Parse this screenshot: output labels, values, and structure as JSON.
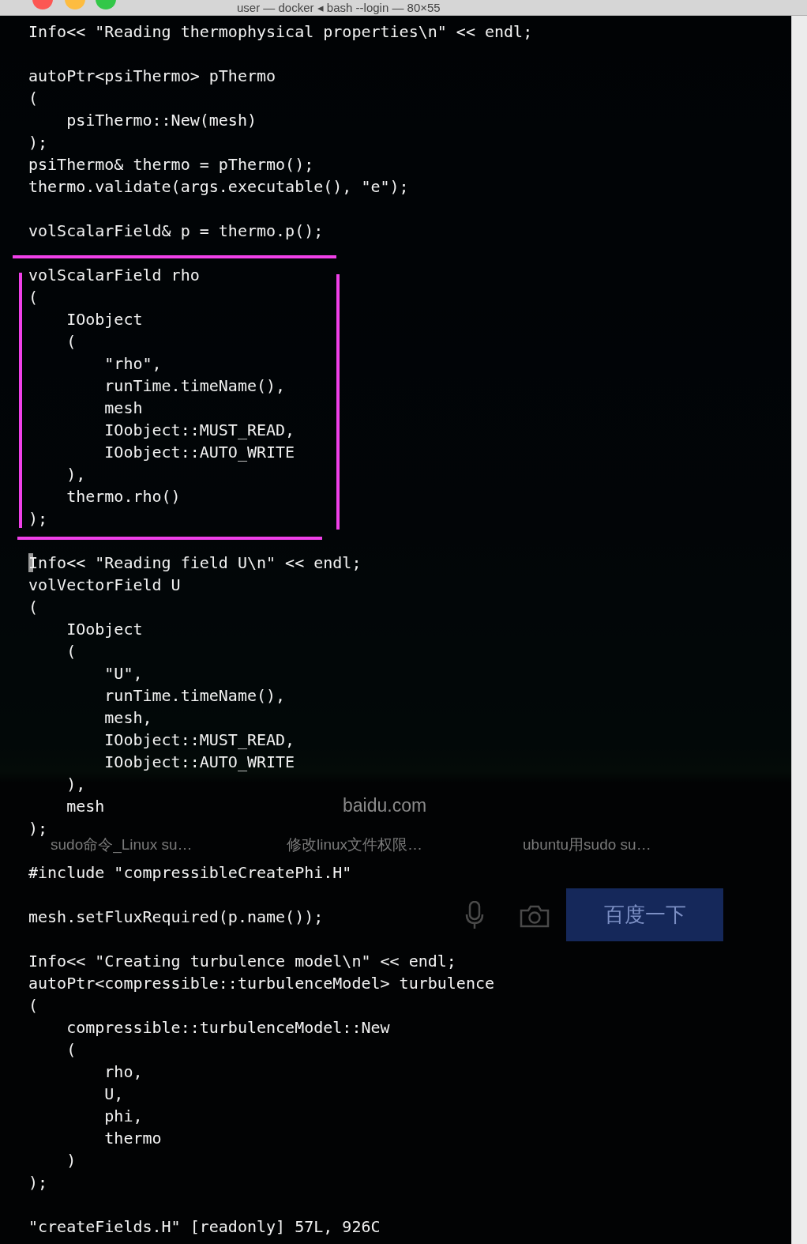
{
  "window": {
    "title": "user — docker ◂ bash --login — 80×55"
  },
  "blocks": [
    {
      "highlighted": false,
      "lines": [
        {
          "text": "Info<< \"Reading thermophysical properties\\n\" << endl;",
          "cursor": false
        }
      ]
    },
    {
      "highlighted": false,
      "lines": [
        {
          "text": "autoPtr<psiThermo> pThermo",
          "cursor": false
        },
        {
          "text": "(",
          "cursor": false
        },
        {
          "text": "    psiThermo::New(mesh)",
          "cursor": false
        },
        {
          "text": ");",
          "cursor": false
        },
        {
          "text": "psiThermo& thermo = pThermo();",
          "cursor": false
        },
        {
          "text": "thermo.validate(args.executable(), \"e\");",
          "cursor": false
        }
      ]
    },
    {
      "highlighted": false,
      "lines": [
        {
          "text": "volScalarField& p = thermo.p();",
          "cursor": false
        }
      ]
    },
    {
      "highlighted": true,
      "lines": [
        {
          "text": "volScalarField rho",
          "cursor": false
        },
        {
          "text": "(",
          "cursor": false
        },
        {
          "text": "    IOobject",
          "cursor": false
        },
        {
          "text": "    (",
          "cursor": false
        },
        {
          "text": "        \"rho\",",
          "cursor": false
        },
        {
          "text": "        runTime.timeName(),",
          "cursor": false
        },
        {
          "text": "        mesh",
          "cursor": false
        },
        {
          "text": "        IOobject::MUST_READ,",
          "cursor": false
        },
        {
          "text": "        IOobject::AUTO_WRITE",
          "cursor": false
        },
        {
          "text": "    ),",
          "cursor": false
        },
        {
          "text": "    thermo.rho()",
          "cursor": false
        },
        {
          "text": ");",
          "cursor": false
        }
      ]
    },
    {
      "highlighted": false,
      "lines": [
        {
          "text": "Info<< \"Reading field U\\n\" << endl;",
          "cursor": true
        },
        {
          "text": "volVectorField U",
          "cursor": false
        },
        {
          "text": "(",
          "cursor": false
        },
        {
          "text": "    IOobject",
          "cursor": false
        },
        {
          "text": "    (",
          "cursor": false
        },
        {
          "text": "        \"U\",",
          "cursor": false
        },
        {
          "text": "        runTime.timeName(),",
          "cursor": false
        },
        {
          "text": "        mesh,",
          "cursor": false
        },
        {
          "text": "        IOobject::MUST_READ,",
          "cursor": false
        },
        {
          "text": "        IOobject::AUTO_WRITE",
          "cursor": false
        },
        {
          "text": "    ),",
          "cursor": false
        },
        {
          "text": "    mesh",
          "cursor": false
        },
        {
          "text": ");",
          "cursor": false
        }
      ]
    },
    {
      "highlighted": false,
      "lines": [
        {
          "text": "#include \"compressibleCreatePhi.H\"",
          "cursor": false
        }
      ]
    },
    {
      "highlighted": false,
      "lines": [
        {
          "text": "mesh.setFluxRequired(p.name());",
          "cursor": false
        }
      ]
    },
    {
      "highlighted": false,
      "lines": [
        {
          "text": "Info<< \"Creating turbulence model\\n\" << endl;",
          "cursor": false
        },
        {
          "text": "autoPtr<compressible::turbulenceModel> turbulence",
          "cursor": false
        },
        {
          "text": "(",
          "cursor": false
        },
        {
          "text": "    compressible::turbulenceModel::New",
          "cursor": false
        },
        {
          "text": "    (",
          "cursor": false
        },
        {
          "text": "        rho,",
          "cursor": false
        },
        {
          "text": "        U,",
          "cursor": false
        },
        {
          "text": "        phi,",
          "cursor": false
        },
        {
          "text": "        thermo",
          "cursor": false
        },
        {
          "text": "    )",
          "cursor": false
        },
        {
          "text": ");",
          "cursor": false
        }
      ]
    }
  ],
  "status_line": "\"createFields.H\" [readonly] 57L, 926C",
  "background_browser": {
    "address": "baidu.com",
    "tabs": [
      "sudo命令_Linux su…",
      "修改linux文件权限…",
      "ubuntu用sudo su…"
    ],
    "search_button": "百度一下"
  }
}
